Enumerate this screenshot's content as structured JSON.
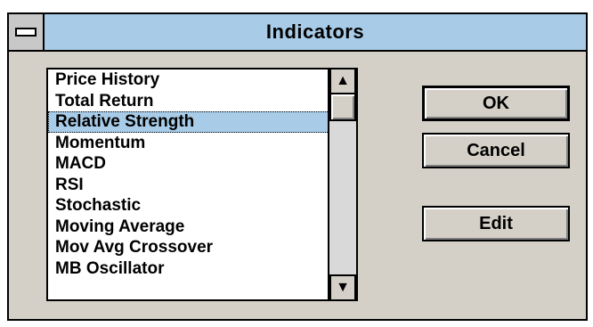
{
  "window": {
    "title": "Indicators"
  },
  "indicators": {
    "items": [
      "Price History",
      "Total Return",
      "Relative Strength",
      "Momentum",
      "MACD",
      "RSI",
      "Stochastic",
      "Moving Average",
      "Mov Avg Crossover",
      "MB Oscillator"
    ],
    "selected": "Relative Strength"
  },
  "scrollbar": {
    "up_icon": "up-arrow-icon",
    "down_icon": "down-arrow-icon"
  },
  "buttons": {
    "ok": "OK",
    "cancel": "Cancel",
    "edit": "Edit"
  },
  "colors": {
    "titlebar": "#a8cce8",
    "selection": "#a8cce8",
    "dialog_bg": "#d4d0c8"
  }
}
